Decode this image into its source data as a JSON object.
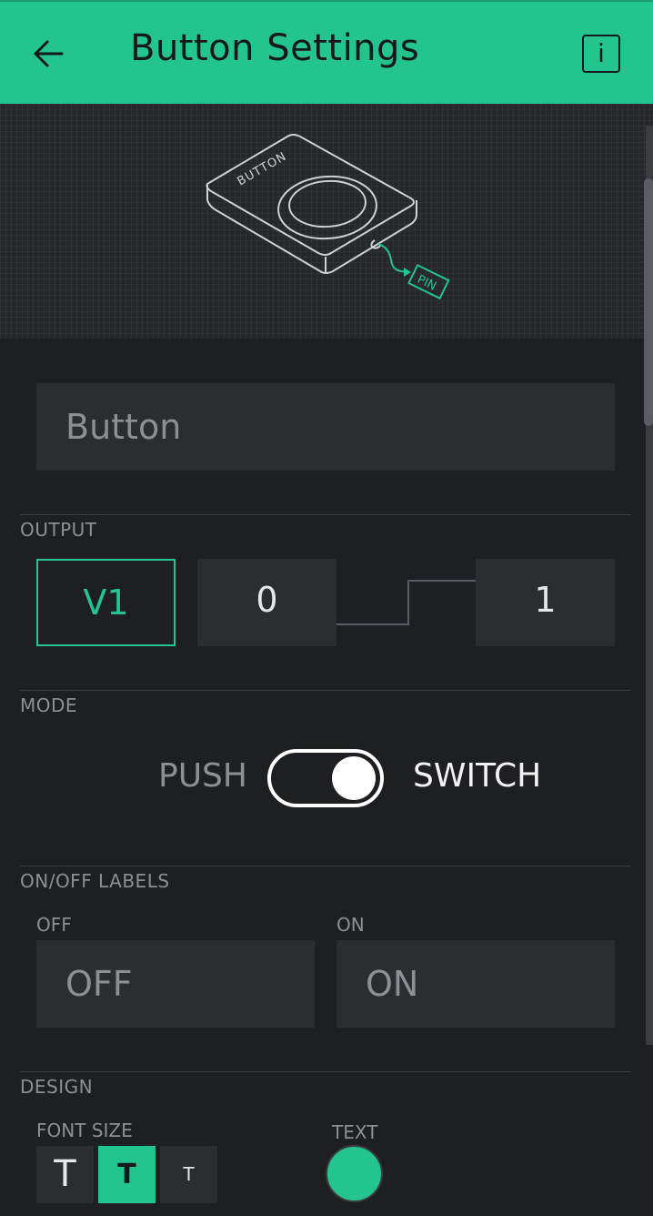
{
  "header": {
    "title": "Button Settings",
    "info_label": "i",
    "back_icon": "arrow-left-icon"
  },
  "illustration": {
    "device_label": "BUTTON",
    "pin_label": "PIN"
  },
  "name_field": {
    "value": "Button"
  },
  "output": {
    "section_label": "OUTPUT",
    "pin": "V1",
    "min": "0",
    "max": "1"
  },
  "mode": {
    "section_label": "MODE",
    "left_label": "PUSH",
    "right_label": "SWITCH",
    "selected": "SWITCH"
  },
  "labels": {
    "section_label": "ON/OFF LABELS",
    "off_label": "OFF",
    "off_value": "OFF",
    "on_label": "ON",
    "on_value": "ON"
  },
  "design": {
    "section_label": "DESIGN",
    "font_size_label": "FONT SIZE",
    "font_sizes": [
      "T",
      "T",
      "T"
    ],
    "selected_font_size": "medium",
    "text_color_label": "TEXT",
    "text_color": "#23c48e"
  },
  "colors": {
    "accent": "#23c48e",
    "background": "#1e1f22",
    "field": "#2b2d31"
  }
}
